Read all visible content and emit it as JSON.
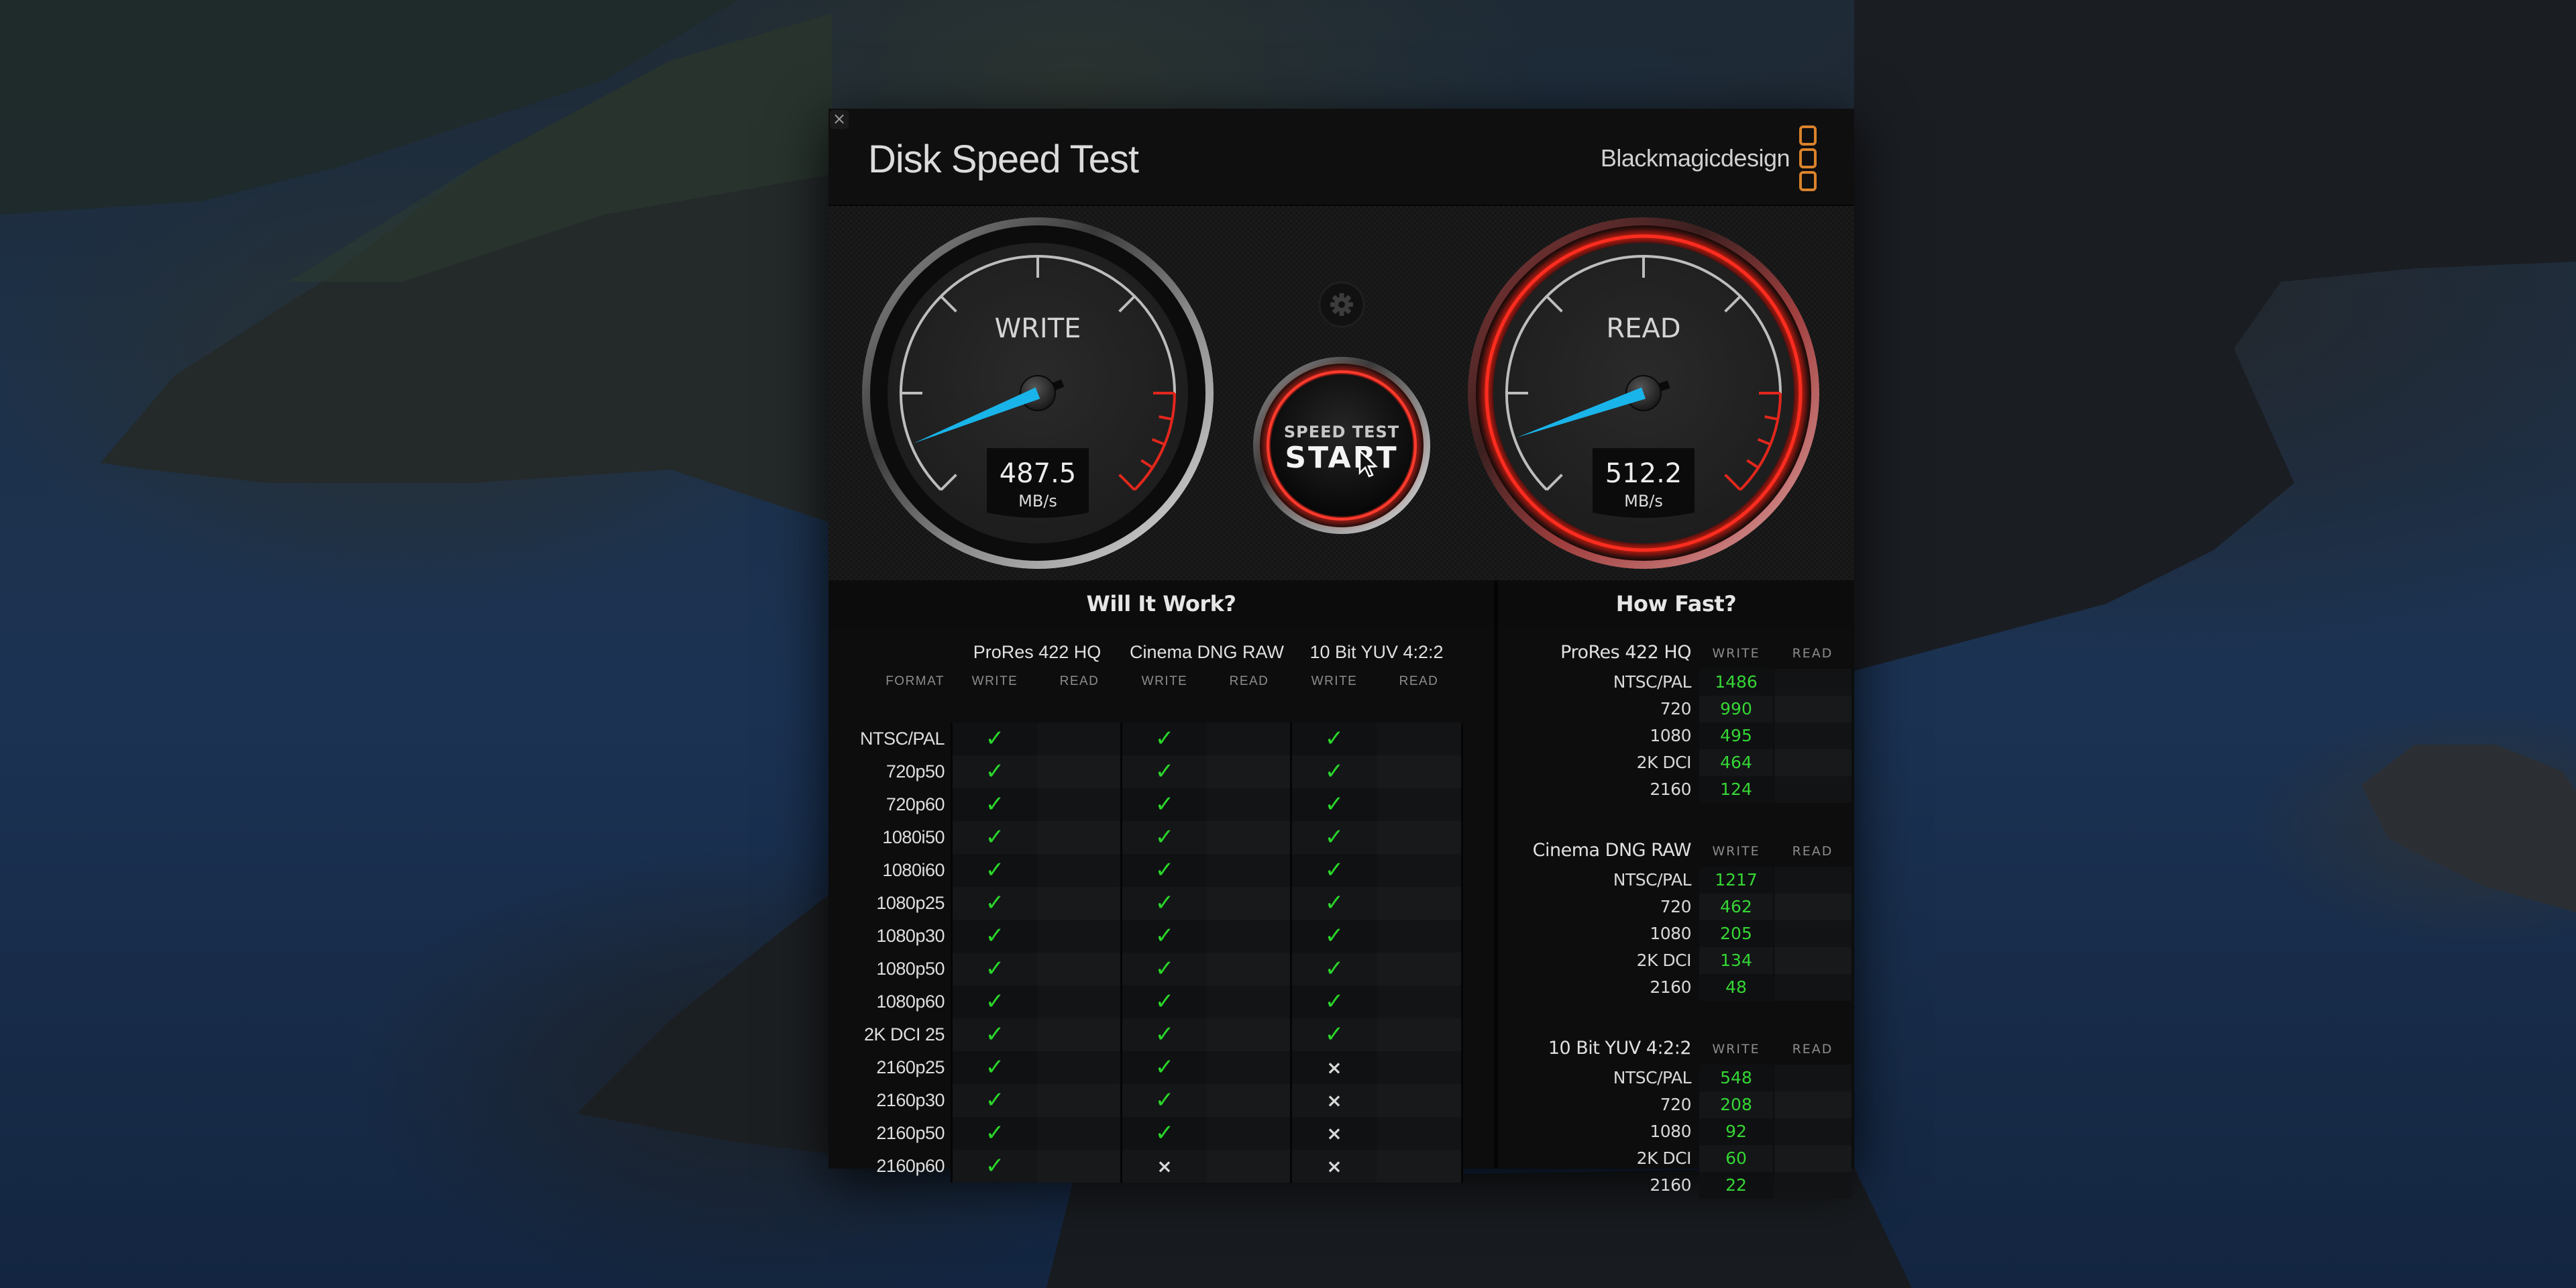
{
  "window": {
    "close_label": "×",
    "title": "Disk Speed Test",
    "brand": "Blackmagicdesign",
    "brand_color": "#d9822b"
  },
  "gauges": {
    "write": {
      "label": "WRITE",
      "value": "487.5",
      "unit": "MB/s",
      "needle_fraction": 0.33
    },
    "read": {
      "label": "READ",
      "value": "512.2",
      "unit": "MB/s",
      "needle_fraction": 0.34
    },
    "needle_color": "#19b4ea",
    "redline_color": "#e2271d"
  },
  "controls": {
    "settings_icon": "gear-icon",
    "start_top": "SPEED TEST",
    "start_main": "START"
  },
  "will_it_work": {
    "title": "Will It Work?",
    "format_header": "FORMAT",
    "write_header": "WRITE",
    "read_header": "READ",
    "codecs": [
      "ProRes 422 HQ",
      "Cinema DNG RAW",
      "10 Bit YUV 4:2:2"
    ],
    "ok_glyph": "✓",
    "no_glyph": "×",
    "rows": [
      {
        "format": "NTSC/PAL",
        "write": [
          "ok",
          "ok",
          "ok"
        ]
      },
      {
        "format": "720p50",
        "write": [
          "ok",
          "ok",
          "ok"
        ]
      },
      {
        "format": "720p60",
        "write": [
          "ok",
          "ok",
          "ok"
        ]
      },
      {
        "format": "1080i50",
        "write": [
          "ok",
          "ok",
          "ok"
        ]
      },
      {
        "format": "1080i60",
        "write": [
          "ok",
          "ok",
          "ok"
        ]
      },
      {
        "format": "1080p25",
        "write": [
          "ok",
          "ok",
          "ok"
        ]
      },
      {
        "format": "1080p30",
        "write": [
          "ok",
          "ok",
          "ok"
        ]
      },
      {
        "format": "1080p50",
        "write": [
          "ok",
          "ok",
          "ok"
        ]
      },
      {
        "format": "1080p60",
        "write": [
          "ok",
          "ok",
          "ok"
        ]
      },
      {
        "format": "2K DCI 25",
        "write": [
          "ok",
          "ok",
          "ok"
        ]
      },
      {
        "format": "2160p25",
        "write": [
          "ok",
          "ok",
          "no"
        ]
      },
      {
        "format": "2160p30",
        "write": [
          "ok",
          "ok",
          "no"
        ]
      },
      {
        "format": "2160p50",
        "write": [
          "ok",
          "ok",
          "no"
        ]
      },
      {
        "format": "2160p60",
        "write": [
          "ok",
          "no",
          "no"
        ]
      }
    ]
  },
  "how_fast": {
    "title": "How Fast?",
    "write_header": "WRITE",
    "read_header": "READ",
    "groups": [
      {
        "codec": "ProRes 422 HQ",
        "rows": [
          {
            "format": "NTSC/PAL",
            "write": "1486",
            "read": ""
          },
          {
            "format": "720",
            "write": "990",
            "read": ""
          },
          {
            "format": "1080",
            "write": "495",
            "read": ""
          },
          {
            "format": "2K DCI",
            "write": "464",
            "read": ""
          },
          {
            "format": "2160",
            "write": "124",
            "read": ""
          }
        ]
      },
      {
        "codec": "Cinema DNG RAW",
        "rows": [
          {
            "format": "NTSC/PAL",
            "write": "1217",
            "read": ""
          },
          {
            "format": "720",
            "write": "462",
            "read": ""
          },
          {
            "format": "1080",
            "write": "205",
            "read": ""
          },
          {
            "format": "2K DCI",
            "write": "134",
            "read": ""
          },
          {
            "format": "2160",
            "write": "48",
            "read": ""
          }
        ]
      },
      {
        "codec": "10 Bit YUV 4:2:2",
        "rows": [
          {
            "format": "NTSC/PAL",
            "write": "548",
            "read": ""
          },
          {
            "format": "720",
            "write": "208",
            "read": ""
          },
          {
            "format": "1080",
            "write": "92",
            "read": ""
          },
          {
            "format": "2K DCI",
            "write": "60",
            "read": ""
          },
          {
            "format": "2160",
            "write": "22",
            "read": ""
          }
        ]
      }
    ]
  }
}
